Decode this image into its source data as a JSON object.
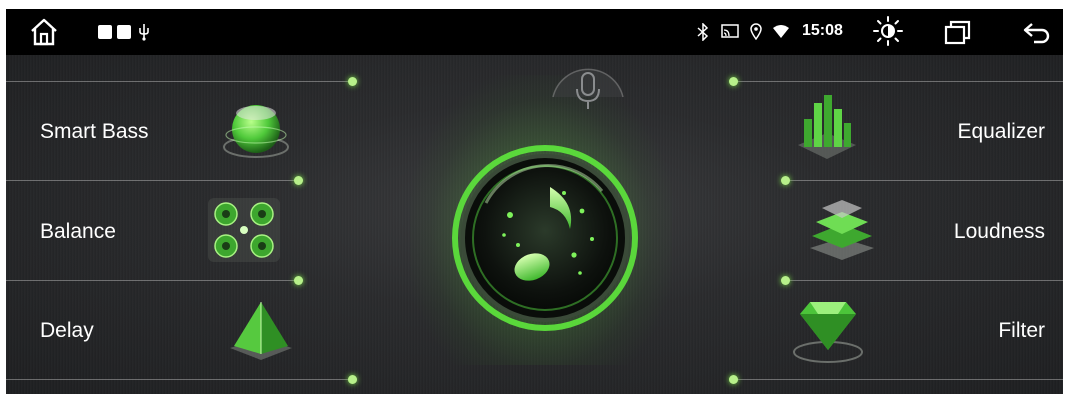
{
  "status_bar": {
    "time": "15:08",
    "icons": [
      "home-icon",
      "app-square-icon",
      "app-square-icon",
      "usb-icon",
      "bluetooth-icon",
      "cast-icon",
      "location-icon",
      "wifi-icon",
      "brightness-icon",
      "recent-apps-icon",
      "back-icon"
    ]
  },
  "left_features": [
    {
      "label": "Smart Bass",
      "icon": "smart-bass-icon"
    },
    {
      "label": "Balance",
      "icon": "balance-icon"
    },
    {
      "label": "Delay",
      "icon": "delay-icon"
    }
  ],
  "right_features": [
    {
      "label": "Equalizer",
      "icon": "equalizer-icon"
    },
    {
      "label": "Loudness",
      "icon": "loudness-icon"
    },
    {
      "label": "Filter",
      "icon": "filter-icon"
    }
  ],
  "center": {
    "icon": "music-note-icon",
    "mic_icon": "microphone-icon"
  },
  "colors": {
    "accent": "#6ee84a",
    "background": "#1d1e1f",
    "status_bar": "#000000",
    "text": "#ffffff"
  }
}
